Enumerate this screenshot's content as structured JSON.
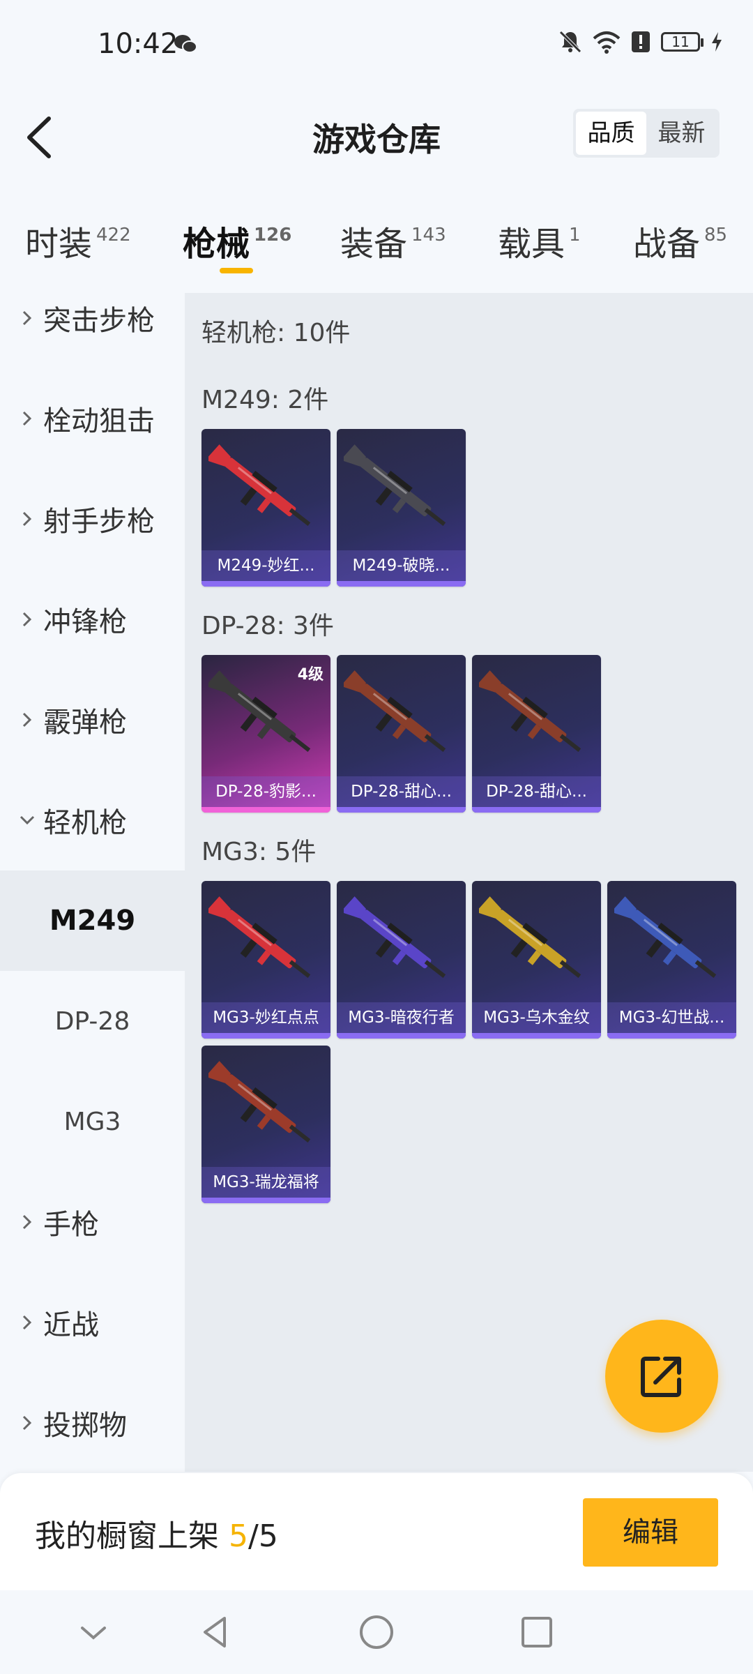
{
  "status_bar": {
    "time": "10:42",
    "battery": "11"
  },
  "header": {
    "title": "游戏仓库",
    "sort_options": [
      "品质",
      "最新"
    ]
  },
  "tabs": [
    {
      "label": "时装",
      "count": "422"
    },
    {
      "label": "枪械",
      "count": "126"
    },
    {
      "label": "装备",
      "count": "143"
    },
    {
      "label": "载具",
      "count": "1"
    },
    {
      "label": "战备",
      "count": "85"
    }
  ],
  "sidebar": {
    "categories": [
      {
        "label": "突击步枪"
      },
      {
        "label": "栓动狙击"
      },
      {
        "label": "射手步枪"
      },
      {
        "label": "冲锋枪"
      },
      {
        "label": "霰弹枪"
      },
      {
        "label": "轻机枪"
      }
    ],
    "subitems": [
      {
        "label": "M249"
      },
      {
        "label": "DP-28"
      },
      {
        "label": "MG3"
      }
    ],
    "more_categories": [
      {
        "label": "手枪"
      },
      {
        "label": "近战"
      },
      {
        "label": "投掷物"
      }
    ]
  },
  "content": {
    "category_heading": "轻机枪: 10件",
    "groups": [
      {
        "heading": "M249: 2件",
        "items": [
          {
            "name": "M249-妙红...",
            "color": "#d8333a"
          },
          {
            "name": "M249-破晓...",
            "color": "#4a4a52"
          }
        ]
      },
      {
        "heading": "DP-28: 3件",
        "items": [
          {
            "name": "DP-28-豹影...",
            "grade": "4级",
            "color": "#3a3a3a"
          },
          {
            "name": "DP-28-甜心...",
            "color": "#8a3e2a"
          },
          {
            "name": "DP-28-甜心...",
            "color": "#8a3e2a"
          }
        ]
      },
      {
        "heading": "MG3: 5件",
        "items": [
          {
            "name": "MG3-妙红点点",
            "color": "#d8333a"
          },
          {
            "name": "MG3-暗夜行者",
            "color": "#5a45c8"
          },
          {
            "name": "MG3-乌木金纹",
            "color": "#c9a227"
          },
          {
            "name": "MG3-幻世战...",
            "color": "#3e5ab8"
          },
          {
            "name": "MG3-瑞龙福将",
            "color": "#9c3b2a"
          }
        ]
      }
    ]
  },
  "bottom_bar": {
    "label": "我的橱窗上架 ",
    "count": "5",
    "total": "/5",
    "edit_button": "编辑"
  },
  "colors": {
    "accent": "#ffb61b",
    "rare_border": "#8a6cf2",
    "epic_border": "#f062d8"
  }
}
